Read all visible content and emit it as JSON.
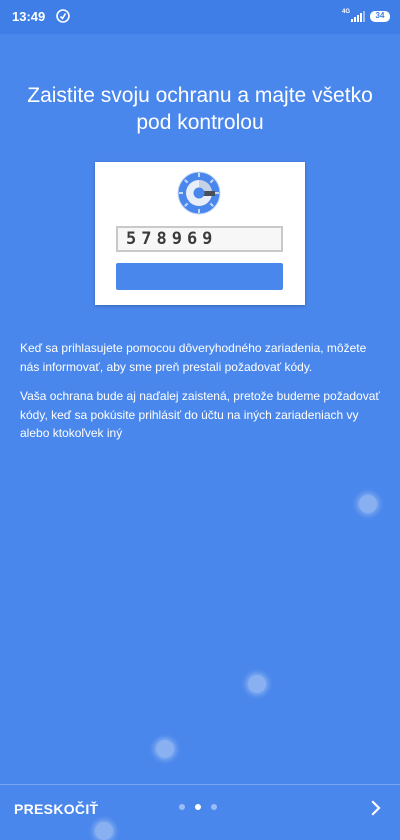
{
  "status_bar": {
    "time": "13:49",
    "network_label": "4G",
    "battery": "34"
  },
  "onboarding": {
    "title": "Zaistite svoju ochranu a majte všetko pod kontrolou",
    "illustration": {
      "code": "578969",
      "logo_icon": "google-authenticator-logo"
    },
    "paragraph_1": "Keď sa prihlasujete pomocou dôveryhodného zariadenia, môžete nás informovať, aby sme preň prestali požadovať kódy.",
    "paragraph_2": "Vaša ochrana bude aj naďalej zaistená, pretože budeme požadovať kódy, keď sa pokúsite prihlásiť do účtu na iných zariadeniach vy alebo ktokoľvek iný"
  },
  "footer": {
    "skip_label": "PRESKOČIŤ",
    "page_count": 3,
    "active_page": 2,
    "next_icon": "chevron-right-icon"
  },
  "colors": {
    "background": "#4a87ec",
    "status_bar": "#3f7ee6",
    "card": "#ffffff",
    "accent": "#4a87ec"
  }
}
